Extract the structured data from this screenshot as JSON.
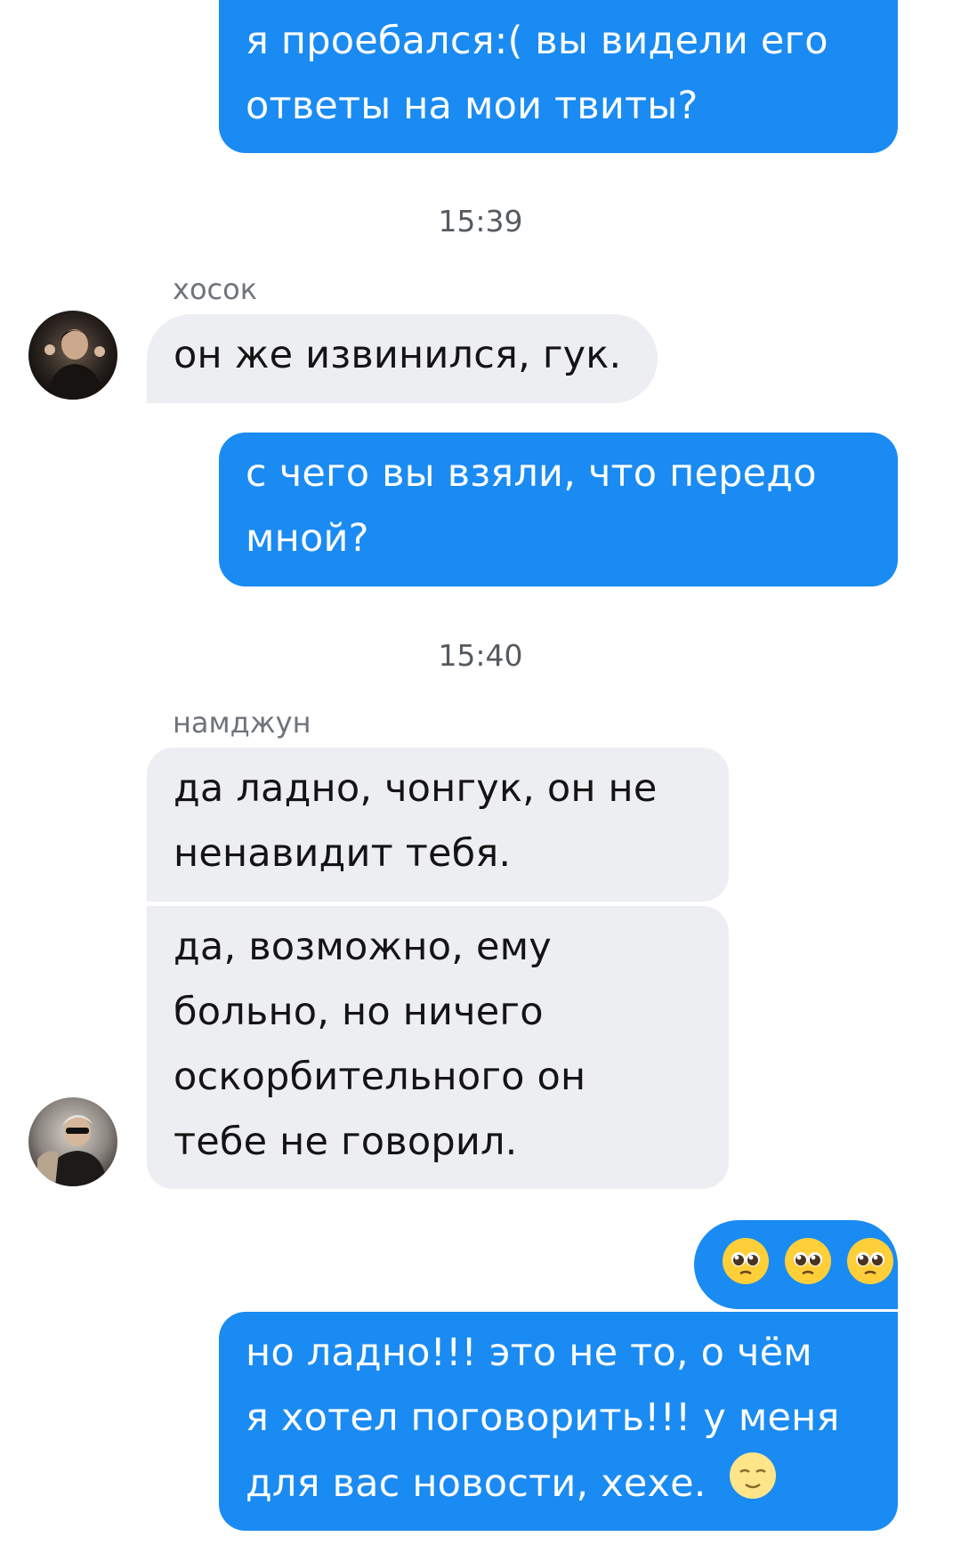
{
  "messages": {
    "m1": {
      "line1": "я проебался:( вы видели его",
      "line2": "ответы на мои твиты?"
    },
    "time1": "15:39",
    "sender1": "хосок",
    "m2": {
      "line1": "он же извинился, гук."
    },
    "m3": {
      "line1": "с чего вы взяли, что передо",
      "line2": "мной?"
    },
    "time2": "15:40",
    "sender2": "намджун",
    "m4": {
      "line1": "да ладно, чонгук, он не",
      "line2": "ненавидит тебя."
    },
    "m5": {
      "line1": "да, возможно, ему",
      "line2": "больно, но ничего",
      "line3": "оскорбительного он",
      "line4": "тебе не говорил."
    },
    "m6": {
      "emoji": "pleading-face-emoji x3"
    },
    "m7": {
      "line1": "но ладно!!! это не то, о чём",
      "line2": "я хотел поговорить!!! у меня",
      "line3": "для вас новости, хехе."
    }
  },
  "icons": {
    "pleading": "pleading-face-emoji",
    "smirk": "smiling-face-emoji"
  },
  "colors": {
    "outgoing_bubble": "#1a8bf2",
    "incoming_bubble": "#edeef1",
    "timestamp": "#555a60",
    "sender_name": "#6f747a"
  }
}
